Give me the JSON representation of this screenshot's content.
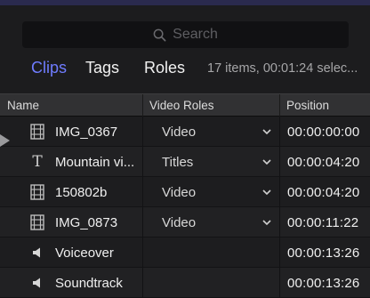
{
  "search": {
    "placeholder": "Search",
    "icon": "magnifier-icon"
  },
  "tabs": {
    "clips": "Clips",
    "tags": "Tags",
    "roles": "Roles"
  },
  "selection_status": "17 items, 00:01:24 selec...",
  "accent_color": "#6f7cff",
  "columns": {
    "name": "Name",
    "video_roles": "Video Roles",
    "position": "Position"
  },
  "rows": [
    {
      "icon": "film-strip-icon",
      "name": "IMG_0367",
      "role": "Video",
      "position": "00:00:00:00"
    },
    {
      "icon": "title-icon",
      "glyph": "T",
      "name": "Mountain vi...",
      "role": "Titles",
      "position": "00:00:04:20"
    },
    {
      "icon": "film-strip-icon",
      "name": "150802b",
      "role": "Video",
      "position": "00:00:04:20"
    },
    {
      "icon": "film-strip-icon",
      "name": "IMG_0873",
      "role": "Video",
      "position": "00:00:11:22"
    },
    {
      "icon": "speaker-icon",
      "name": "Voiceover",
      "role": "",
      "position": "00:00:13:26"
    },
    {
      "icon": "speaker-icon",
      "name": "Soundtrack",
      "role": "",
      "position": "00:00:13:26"
    }
  ]
}
